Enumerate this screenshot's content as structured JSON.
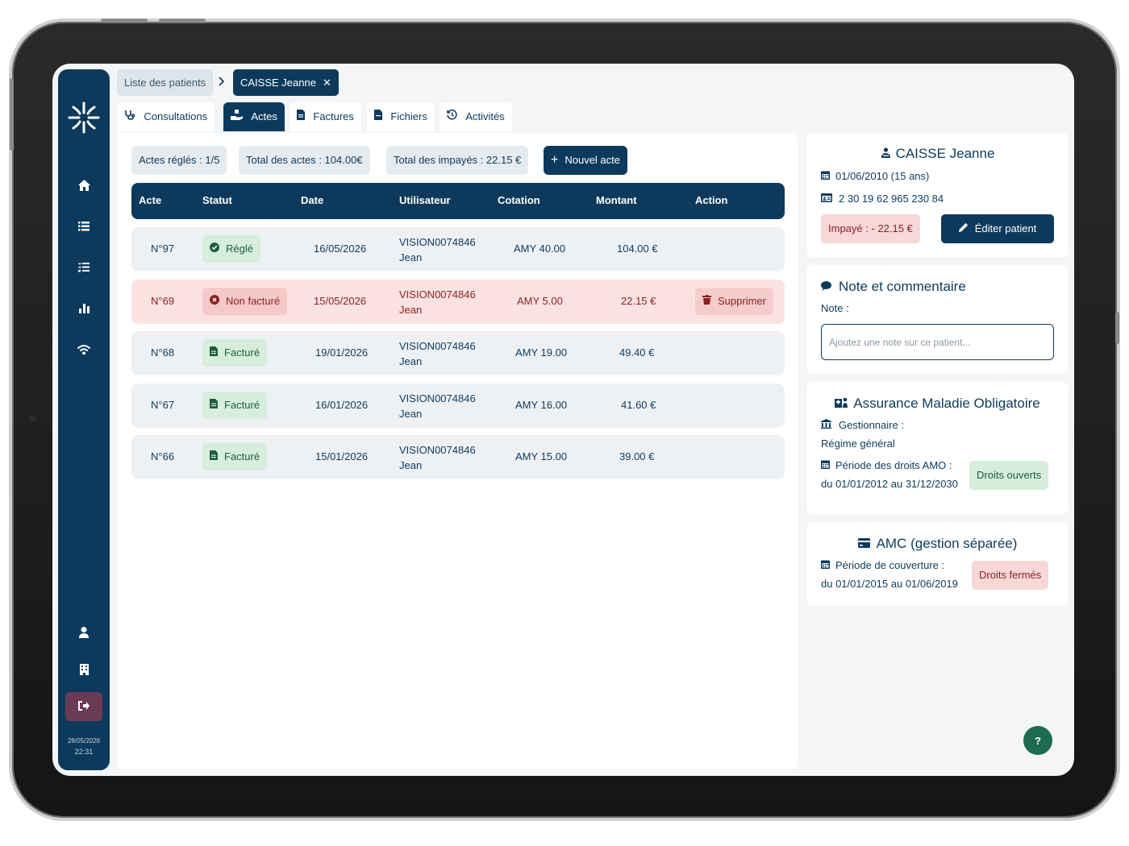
{
  "sidebar": {
    "icons": [
      "home-icon",
      "list-icon",
      "checklist-icon",
      "chart-icon",
      "wifi-icon",
      "user-icon",
      "building-icon",
      "logout-icon"
    ],
    "date": "28/05/2026",
    "time": "22:31"
  },
  "breadcrumb": {
    "list_label": "Liste des patients",
    "current_label": "CAISSE Jeanne",
    "close": "✕"
  },
  "tabs": [
    {
      "label": "Consultations",
      "active": false
    },
    {
      "label": "Actes",
      "active": true
    },
    {
      "label": "Factures",
      "active": false
    },
    {
      "label": "Fichiers",
      "active": false
    },
    {
      "label": "Activités",
      "active": false
    }
  ],
  "stats": {
    "actes_regles": "Actes réglés : 1/5",
    "total_actes": "Total des actes : 104.00€",
    "total_impayes": "Total des impayés : 22.15 €",
    "new_button": "Nouvel acte"
  },
  "table": {
    "headers": [
      "Acte",
      "Statut",
      "Date",
      "Utilisateur",
      "Cotation",
      "Montant",
      "Action"
    ],
    "rows": [
      {
        "acte": "N°97",
        "statut": "Réglé",
        "date": "16/05/2026",
        "user1": "VISION0074846",
        "user2": "Jean",
        "cotation": "AMY 40.00",
        "montant": "104.00 €",
        "action": ""
      },
      {
        "acte": "N°69",
        "statut": "Non facturé",
        "date": "15/05/2026",
        "user1": "VISION0074846",
        "user2": "Jean",
        "cotation": "AMY 5.00",
        "montant": "22.15 €",
        "action": "Supprimer"
      },
      {
        "acte": "N°68",
        "statut": "Facturé",
        "date": "19/01/2026",
        "user1": "VISION0074846",
        "user2": "Jean",
        "cotation": "AMY 19.00",
        "montant": "49.40 €",
        "action": ""
      },
      {
        "acte": "N°67",
        "statut": "Facturé",
        "date": "16/01/2026",
        "user1": "VISION0074846",
        "user2": "Jean",
        "cotation": "AMY 16.00",
        "montant": "41.60 €",
        "action": ""
      },
      {
        "acte": "N°66",
        "statut": "Facturé",
        "date": "15/01/2026",
        "user1": "VISION0074846",
        "user2": "Jean",
        "cotation": "AMY 15.00",
        "montant": "39.00 €",
        "action": ""
      }
    ]
  },
  "patient": {
    "name": "CAISSE  Jeanne",
    "birth": "01/06/2010 (15 ans)",
    "ssn": "2 30 19 62 965 230 84",
    "impaye": "Impayé : -  22.15  €",
    "edit_button": "Éditer patient"
  },
  "note": {
    "title": "Note et commentaire",
    "label": "Note :",
    "placeholder": "Ajoutez une note sur ce patient..."
  },
  "amo": {
    "title": "Assurance Maladie Obligatoire",
    "gestionnaire_label": "Gestionnaire :",
    "gestionnaire_value": "Régime général",
    "periode_label": "Période des droits AMO :",
    "periode_value": "du 01/01/2012 au 31/12/2030",
    "status": "Droits ouverts"
  },
  "amc": {
    "title": "AMC (gestion séparée)",
    "periode_label": "Période de couverture :",
    "periode_value": "du 01/01/2015 au 01/06/2019",
    "status": "Droits fermés"
  },
  "help": "?",
  "colors": {
    "primary": "#0d3a5c",
    "success": "#1f5d3d",
    "danger": "#8a1f1f",
    "background": "#f3f5f7"
  }
}
